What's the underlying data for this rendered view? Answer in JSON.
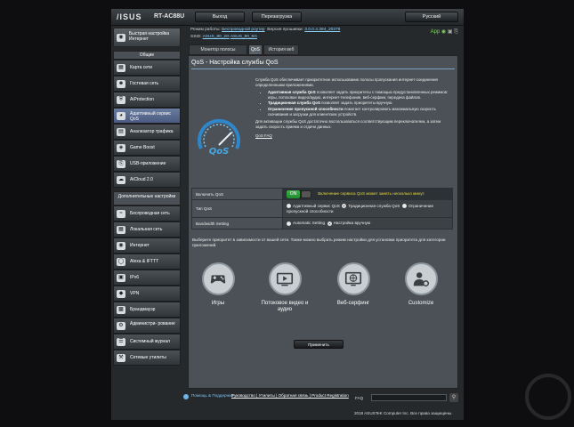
{
  "header": {
    "brand": "/ISUS",
    "model": "RT-AC88U",
    "logout": "Выход",
    "reboot": "Перезагрузка",
    "language": "Русский"
  },
  "status": {
    "mode_label": "Режим работы:",
    "mode_value": "Беспроводной роутер",
    "fw_label": "Версия прошивки:",
    "fw_value": "3.0.0.4.384_20379",
    "ssid_label": "SSID:",
    "ssid1": "ASUS_80_2G",
    "ssid2": "ASUS_80_5G",
    "app": "App"
  },
  "sidebar": {
    "quick": "Быстрая настройка Интернет",
    "general": "Общие",
    "items": [
      "Карта сети",
      "Гостевая сеть",
      "AiProtection",
      "Адаптивный сервис QoS",
      "Анализатор трафика",
      "Game Boost",
      "USB-приложение",
      "AiCloud 2.0"
    ],
    "advanced": "Дополнительные настройки",
    "adv_items": [
      "Беспроводная сеть",
      "Локальная сеть",
      "Интернет",
      "Alexa & IFTTT",
      "IPv6",
      "VPN",
      "Брандмауэр",
      "Администри- рование",
      "Системный журнал",
      "Сетевые утилиты"
    ]
  },
  "tabs": [
    "Монитор полосы пропускания",
    "QoS",
    "История веб"
  ],
  "main": {
    "title": "QoS - Настройка службы QoS",
    "intro": "Служба QoS обеспечивает приоритетное использование полосы пропускания интернет-соединения определенными приложениями.",
    "b1_bold": "Адаптивная служба QoS",
    "b1": " позволяет задать приоритеты с помощью предустановленных режимов: игры, потоковое видео/аудио, интернет-телефония, веб-серфинг, передача файлов.",
    "b2_bold": "Традиционная служба QoS",
    "b2": " позволяет задать приоритеты вручную.",
    "b3_bold": "Ограничение пропускной способности",
    "b3": " помогает контролировать максимальную скорость скачивания и загрузки для клиентских устройств.",
    "note": "Для активации службы QoS достаточно воспользоваться соответствующим переключателем, а затем задать скорость приема и отдачи данных.",
    "faq": "QoS FAQ",
    "gauge_text": "QoS"
  },
  "settings": {
    "enable_label": "Включить QoS",
    "enable_state": "ON",
    "enable_warn": "Включение сервиса QoS может занять несколько минут.",
    "type_label": "Тип QoS",
    "type_opt1": "Адаптивный сервис QoS",
    "type_opt2": "Традиционная служба QoS",
    "type_opt3": "Ограничение пропускной способности",
    "bw_label": "Bandwidth Setting",
    "bw_opt1": "Automatic Setting",
    "bw_opt2": "Настройка вручную"
  },
  "priority": {
    "text": "Выберите приоритет в зависимости от вашей сети. Также можно выбрать режим настройки для установки приоритета для категории приложений.",
    "cats": [
      "Игры",
      "Потоковое видео и аудио",
      "Веб-серфинг",
      "Customize"
    ],
    "apply": "Применить"
  },
  "footer": {
    "help": "Помощь & Поддержка",
    "links": "Руководство | Утилиты | Обратная связь | Product Registration",
    "faq": "FAQ",
    "copyright": "2018 ASUSTeK Computer Inc. Все права защищены."
  },
  "colors": {
    "accent": "#7aa3c0",
    "on": "#2e9e3a",
    "warn": "#e8d93d"
  }
}
